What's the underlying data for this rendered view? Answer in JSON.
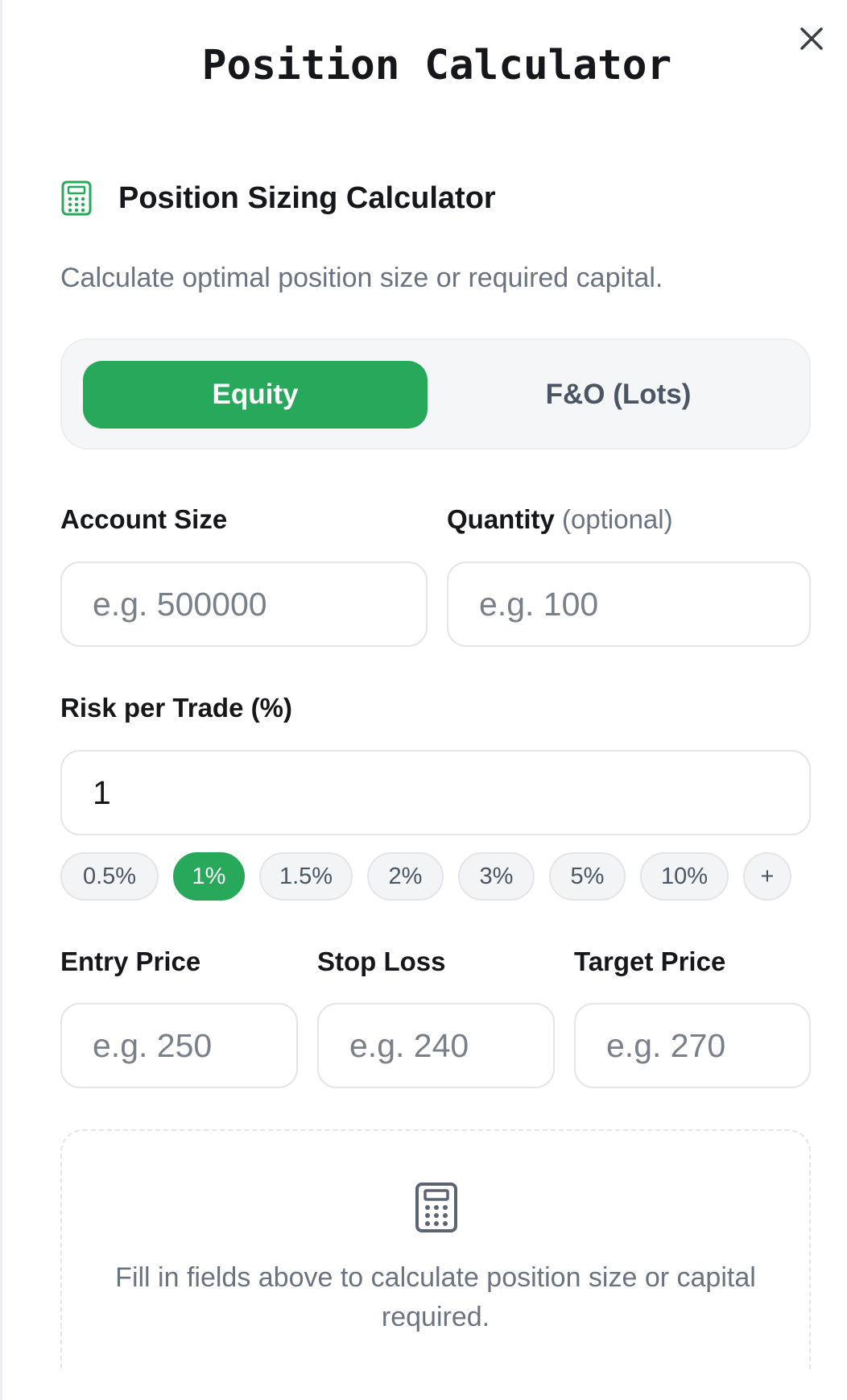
{
  "dialog": {
    "title": "Position Calculator",
    "close_icon": "close-icon"
  },
  "section": {
    "icon": "calculator-icon",
    "title": "Position Sizing Calculator",
    "subtitle": "Calculate optimal position size or required capital."
  },
  "mode_toggle": {
    "options": [
      "Equity",
      "F&O (Lots)"
    ],
    "selected": "Equity"
  },
  "fields": {
    "account_size": {
      "label": "Account Size",
      "placeholder": "e.g. 500000",
      "value": ""
    },
    "quantity": {
      "label": "Quantity",
      "label_suffix": "(optional)",
      "placeholder": "e.g. 100",
      "value": ""
    },
    "risk_per_trade": {
      "label": "Risk per Trade (%)",
      "value": "1"
    },
    "entry_price": {
      "label": "Entry Price",
      "placeholder": "e.g. 250",
      "value": ""
    },
    "stop_loss": {
      "label": "Stop Loss",
      "placeholder": "e.g. 240",
      "value": ""
    },
    "target_price": {
      "label": "Target Price",
      "placeholder": "e.g. 270",
      "value": ""
    }
  },
  "risk_presets": {
    "options": [
      "0.5%",
      "1%",
      "1.5%",
      "2%",
      "3%",
      "5%",
      "10%",
      "+"
    ],
    "selected": "1%"
  },
  "result": {
    "icon": "calculator-icon",
    "empty_message": "Fill in fields above to calculate position size or capital required."
  },
  "colors": {
    "accent": "#27a85a",
    "text_primary": "#15171a",
    "text_muted": "#6b7280"
  }
}
